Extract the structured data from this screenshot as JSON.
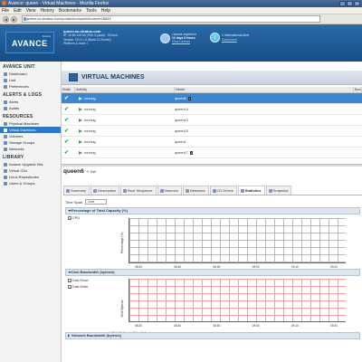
{
  "window": {
    "title": "Avance: queen - Virtual Machines - Mozilla Firefox",
    "buttons": [
      "_",
      "□",
      "×"
    ]
  },
  "menu": [
    "File",
    "Edit",
    "View",
    "History",
    "Bookmarks",
    "Tools",
    "Help"
  ],
  "nav": {
    "url": "queen.cs.stratus.com/portal/#consoleMcomvm28844",
    "back": "◀",
    "forward": "▶"
  },
  "header": {
    "logo_by": "Stratus",
    "logo_text": "AVANCE",
    "host": "queen.sn.stratus.com",
    "info_lines": [
      "IP: 10.84.119.64 | Eth: 0 (auto) - 5G/cmt",
      "Version: R2.0.1.0 (Build 10.2/cmt0)",
      "Platform & more >"
    ],
    "license": {
      "line1": "License expires in",
      "days": "13 days 6 hours",
      "link": "View License"
    },
    "info": {
      "line1": "1 Informational Alert",
      "link": "Dashboard"
    }
  },
  "sidebar": {
    "sections": [
      {
        "title": "AVANCE UNIT",
        "items": [
          "Dashboard",
          "Unit",
          "Preferences"
        ]
      },
      {
        "title": "ALERTS & LOGS",
        "items": [
          "Alerts",
          "Audits"
        ]
      },
      {
        "title": "RESOURCES",
        "items": [
          "Physical Machines",
          "Virtual Machines",
          "Volumes",
          "Storage Groups",
          "Networks"
        ]
      },
      {
        "title": "LIBRARY",
        "items": [
          "Avance Upgrade Kits",
          "Virtual CDs",
          "Linux Repositories",
          "Users & Groups"
        ]
      }
    ],
    "active": "Virtual Machines"
  },
  "vm_panel": {
    "title": "VIRTUAL MACHINES",
    "columns": [
      "State",
      "Activity",
      "Name",
      "Boot"
    ]
  },
  "vms": [
    {
      "state": "✔",
      "activity": "running",
      "name": "queen6",
      "badge": "2"
    },
    {
      "state": "✔",
      "activity": "running",
      "name": "queen14",
      "badge": ""
    },
    {
      "state": "✔",
      "activity": "running",
      "name": "queen13",
      "badge": ""
    },
    {
      "state": "✔",
      "activity": "running",
      "name": "queen15",
      "badge": ""
    },
    {
      "state": "✔",
      "activity": "running",
      "name": "queen1",
      "badge": ""
    },
    {
      "state": "✔",
      "activity": "running",
      "name": "queen17",
      "badge": "2"
    }
  ],
  "detail": {
    "title": "queen6",
    "edit": "Edit"
  },
  "tabs": [
    "Summary",
    "Description",
    "Boot Sequence",
    "Volumes",
    "Networks",
    "CD Drives",
    "Statistics",
    "Snapshot"
  ],
  "active_tab": "Statistics",
  "timespan": {
    "label": "Time Span:",
    "value": "Live"
  },
  "panels": {
    "cpu": {
      "title": "Percentage of Total Capacity (%)",
      "checkbox": "CPU",
      "ylabel": "Percentage (%)",
      "legend": [
        "CPU: 0"
      ]
    },
    "disk": {
      "title": "Disk Bandwidth (bytes/s)",
      "checkboxes": [
        "Disk Read",
        "Disk Write"
      ],
      "ylabel": "Disk Bytes/s",
      "legend": [
        "Disk_R: 0",
        "Disk_W: 0"
      ]
    },
    "net": {
      "title": "Network Bandwidth (bytes/s)"
    }
  },
  "chart_data": [
    {
      "type": "line",
      "title": "Percentage of Total Capacity (%)",
      "ylabel": "Percentage (%)",
      "x": [
        "08:30",
        "08:40",
        "08:50",
        "09:00",
        "09:10",
        "09:20"
      ],
      "series": [
        {
          "name": "CPU",
          "values": [
            0,
            0,
            0,
            0,
            0,
            0
          ]
        }
      ],
      "ylim": [
        0,
        10
      ],
      "grid": true
    },
    {
      "type": "line",
      "title": "Disk Bandwidth (bytes/s)",
      "ylabel": "Disk Bytes/s",
      "x": [
        "08:30",
        "08:40",
        "08:50",
        "09:00",
        "09:10",
        "09:20"
      ],
      "series": [
        {
          "name": "Disk_R",
          "values": [
            0,
            0,
            0,
            0,
            0,
            0
          ]
        },
        {
          "name": "Disk_W",
          "values": [
            0,
            0,
            0,
            0,
            0,
            0
          ]
        }
      ],
      "ylim": [
        0,
        10
      ],
      "grid": true
    }
  ],
  "colors": {
    "header": "#1f5c98",
    "active_row": "#3b86d1",
    "grid": "#ff9b9b"
  }
}
